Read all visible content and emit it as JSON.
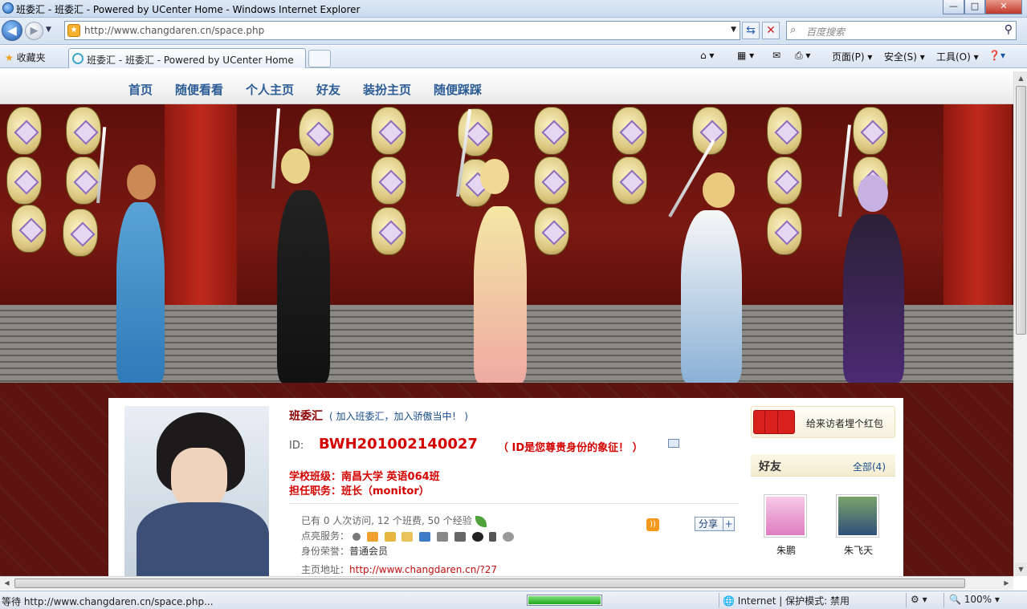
{
  "window": {
    "title": "班委汇 - 班委汇 - Powered by UCenter Home - Windows Internet Explorer",
    "controls": {
      "minimize": "—",
      "maximize": "□",
      "close": "✕"
    }
  },
  "address_bar": {
    "url": "http://www.changdaren.cn/space.php",
    "search_placeholder": "百度搜索"
  },
  "command_bar": {
    "favorites_label": "收藏夹",
    "tab_title": "班委汇 - 班委汇 - Powered by UCenter Home",
    "menus": {
      "page": "页面(P)",
      "safety": "安全(S)",
      "tools": "工具(O)"
    }
  },
  "site_nav": {
    "items": [
      "首页",
      "随便看看",
      "个人主页",
      "好友",
      "装扮主页",
      "随便踩踩"
    ]
  },
  "profile": {
    "name": "班委汇",
    "join_text": "( 加入班委汇，加入骄傲当中！ )",
    "id_label": "ID:",
    "id_value": "BWH201002140027",
    "id_note": "（ ID是您尊贵身份的象征！ ）",
    "school": "学校班级：南昌大学 英语064班",
    "duty": "担任职务：班长（monitor）",
    "stats": "已有 0 人次访问, 12 个班费, 50 个经验",
    "services_label": "点亮服务：",
    "honor_label": "身份荣誉：",
    "honor_value": "普通会员",
    "homepage_label": "主页地址：",
    "homepage_value": "http://www.changdaren.cn/?27",
    "share_label": "分享",
    "share_plus": "+"
  },
  "sidebar": {
    "red_packet_text": "给来访者埋个红包",
    "friends_title": "好友",
    "friends_all": "全部(4)",
    "friends": [
      {
        "name": "朱鹏"
      },
      {
        "name": "朱飞天"
      }
    ]
  },
  "status_bar": {
    "status_text": "等待 http://www.changdaren.cn/space.php...",
    "progress": 1.0,
    "zone": "Internet | 保护模式: 禁用",
    "zoom": "100%"
  }
}
